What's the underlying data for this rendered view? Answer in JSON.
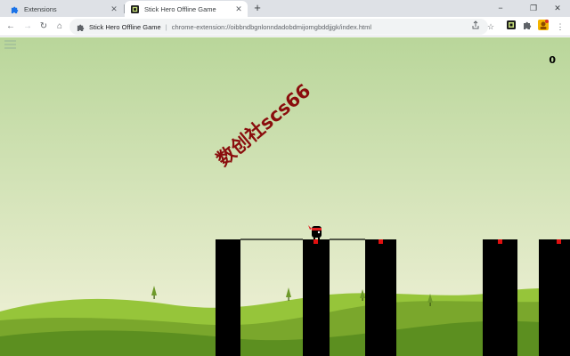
{
  "browser": {
    "tabs": [
      {
        "label": "Extensions",
        "icon": "puzzle-icon",
        "active": false
      },
      {
        "label": "Stick Hero Offline Game",
        "icon": "stick-hero-favicon",
        "active": true
      }
    ],
    "new_tab_glyph": "+",
    "window_controls": {
      "minimize": "−",
      "restore": "❐",
      "close": "✕"
    },
    "nav": {
      "back": "←",
      "forward": "→",
      "reload": "↻",
      "home": "⌂"
    },
    "omnibox": {
      "site_name": "Stick Hero Offline Game",
      "url": "chrome-extension://oibbndbgnlonndadobdmijomgbddjjgk/index.html"
    },
    "toolbar_icons": [
      "share-icon",
      "bookmark-star-icon",
      "stick-hero-extension-icon",
      "extensions-puzzle-icon",
      "profile-icon",
      "kebab-menu-icon"
    ]
  },
  "game": {
    "score": "0",
    "watermark": "数创社scs66",
    "colors": {
      "sky_top": "#b9d69a",
      "sky_bottom": "#f2f2da",
      "hill_back": "#96c53a",
      "hill_mid": "#7aa72c",
      "hill_front": "#5c8f20",
      "pillar": "#000000",
      "perfect_zone": "#e01010",
      "hero_band": "#e02020",
      "stick": "#000000"
    }
  }
}
